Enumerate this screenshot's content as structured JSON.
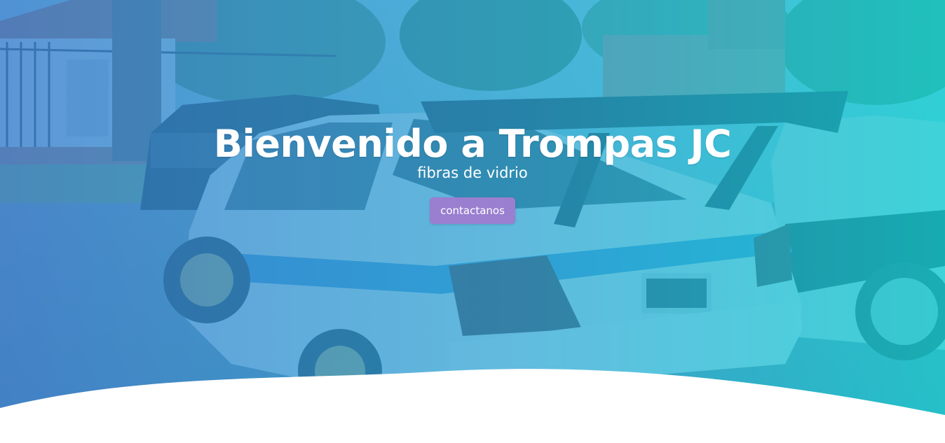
{
  "hero": {
    "title": "Bienvenido a Trompas JC",
    "subtitle": "fibras de vidrio",
    "cta_label": "contactanos",
    "background_image": "car-photo",
    "overlay_colors": [
      "#3a8fd6",
      "#16c8d8"
    ],
    "button_color": "#9a7fd0"
  }
}
